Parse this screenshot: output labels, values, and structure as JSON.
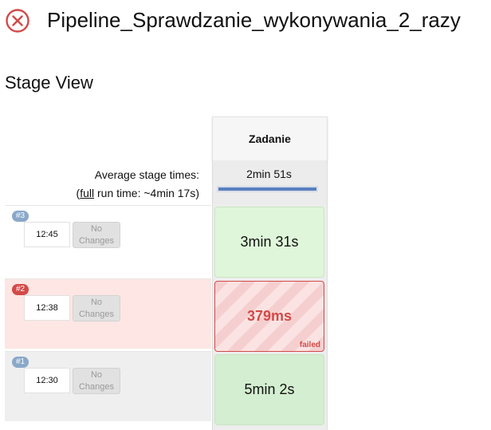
{
  "header": {
    "title": "Pipeline_Sprawdzanie_wykonywania_2_razy",
    "status_icon": "failed-circle-x-icon",
    "status_color": "#d24a48"
  },
  "section": {
    "title": "Stage View"
  },
  "stage_view": {
    "stage": {
      "name": "Zadanie",
      "avg_time": "2min 51s"
    },
    "avg_label": "Average stage times:",
    "full_prefix": "(",
    "full_link": "full",
    "full_suffix": " run time: ~4min 17s)",
    "runs": [
      {
        "badge": "#3",
        "time": "12:45",
        "changes_1": "No",
        "changes_2": "Changes",
        "cell_text": "3min 31s",
        "status": "success"
      },
      {
        "badge": "#2",
        "time": "12:38",
        "changes_1": "No",
        "changes_2": "Changes",
        "cell_text": "379ms",
        "status": "failed",
        "status_label": "failed"
      },
      {
        "badge": "#1",
        "time": "12:30",
        "changes_1": "No",
        "changes_2": "Changes",
        "cell_text": "5min 2s",
        "status": "success"
      }
    ]
  },
  "colors": {
    "success_bg": "#dff6da",
    "failed": "#d24a48",
    "avg_bar": "#5a7fbf"
  }
}
